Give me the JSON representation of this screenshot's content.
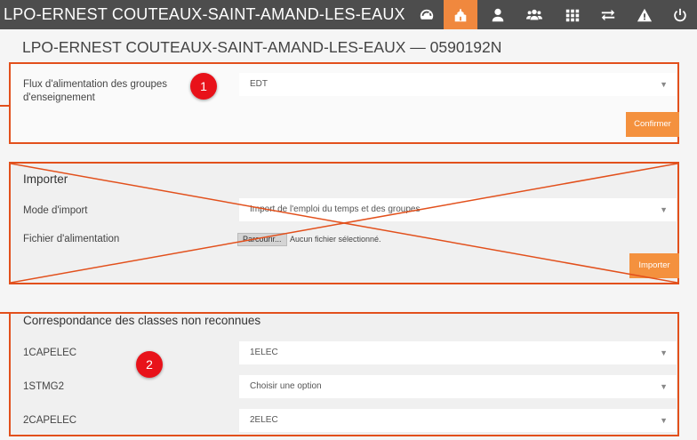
{
  "app": {
    "title": "LPO-ERNEST COUTEAUX-SAINT-AMAND-LES-EAUX"
  },
  "nav": {
    "icons": [
      "dashboard-icon",
      "school-icon",
      "user-icon",
      "group-icon",
      "grid-icon",
      "transfer-icon",
      "warning-icon",
      "power-icon"
    ],
    "active": "school-icon",
    "accent": "#f0883e"
  },
  "page": {
    "title": "LPO-ERNEST COUTEAUX-SAINT-AMAND-LES-EAUX — 0590192N"
  },
  "flux": {
    "label": "Flux d'alimentation des groupes d'enseignement",
    "value": "EDT",
    "confirm_label": "Confirmer",
    "badge": "1"
  },
  "importer": {
    "title": "Importer",
    "mode_label": "Mode d'import",
    "mode_value": "Import de l'emploi du temps et des groupes",
    "file_label": "Fichier d'alimentation",
    "browse_label": "Parcourir...",
    "file_status": "Aucun fichier sélectionné.",
    "import_label": "Importer"
  },
  "correspondance": {
    "title": "Correspondance des classes non reconnues",
    "badge": "2",
    "rows": [
      {
        "class": "1CAPELEC",
        "value": "1ELEC"
      },
      {
        "class": "1STMG2",
        "value": "Choisir une option"
      },
      {
        "class": "2CAPELEC",
        "value": "2ELEC"
      }
    ]
  },
  "colors": {
    "annotation": "#e2501c",
    "badge": "#e8121a",
    "button": "#f4913e"
  }
}
